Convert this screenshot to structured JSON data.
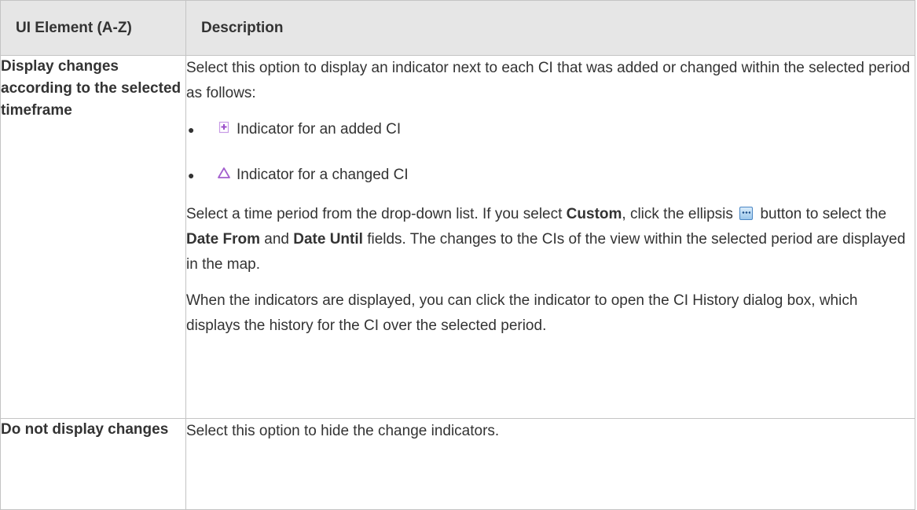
{
  "table": {
    "headers": {
      "element": "UI Element (A-Z)",
      "description": "Description"
    },
    "rows": [
      {
        "element": "Display changes according to the selected timeframe",
        "intro": "Select this option to display an indicator next to each CI that was added or changed within the selected period as follows:",
        "indicators": [
          {
            "icon": "added-ci-icon",
            "text": "Indicator for an added CI"
          },
          {
            "icon": "changed-ci-icon",
            "text": "Indicator for a changed CI"
          }
        ],
        "para2": {
          "part1": "Select a time period from the drop-down list. If you select ",
          "bold1": "Custom",
          "part2": ", click the ellipsis ",
          "part3": " button to select the ",
          "bold2": "Date From",
          "part4": " and ",
          "bold3": "Date Until",
          "part5": " fields. The changes to the CIs of the view within the selected period are displayed in the map."
        },
        "para3": "When the indicators are displayed, you can click the indicator to open the CI History dialog box, which displays the history for the CI over the selected period."
      },
      {
        "element": "Do not display changes",
        "description": "Select this option to hide the change indicators."
      }
    ]
  },
  "colors": {
    "header_bg": "#e6e6e6",
    "border": "#c4c4c4",
    "text": "#333333",
    "indicator": "#a35fce"
  }
}
